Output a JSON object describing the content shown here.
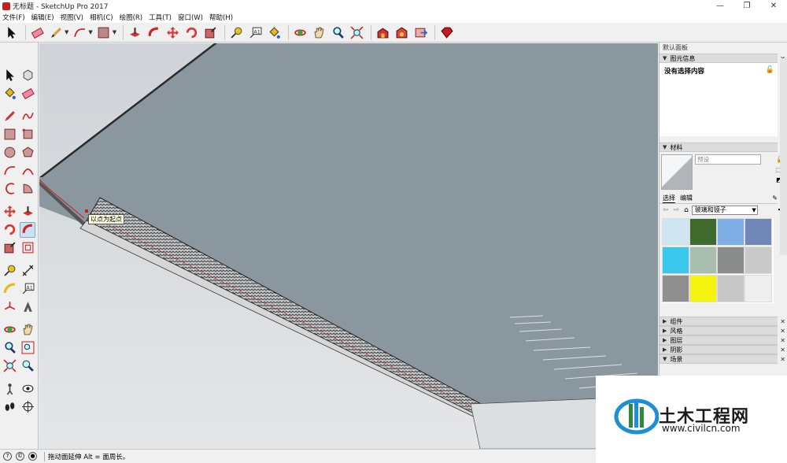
{
  "window": {
    "title": "无标题 - SketchUp Pro 2017",
    "controls": [
      "—",
      "❐",
      "✕"
    ]
  },
  "menu": [
    "文件(F)",
    "编辑(E)",
    "视图(V)",
    "相机(C)",
    "绘图(R)",
    "工具(T)",
    "窗口(W)",
    "帮助(H)"
  ],
  "toolbar": {
    "icons": [
      "select-icon",
      "eraser-icon",
      "pencil-icon",
      "arc-icon",
      "rectangle-icon",
      "push-pull-icon",
      "follow-me-icon",
      "move-icon",
      "rotate-icon",
      "scale-icon",
      "tape-measure-icon",
      "text-icon",
      "paint-bucket-icon",
      "orbit-icon",
      "pan-icon",
      "zoom-icon",
      "zoom-extents-icon",
      "warehouse-icon",
      "extension-warehouse-icon",
      "layout-icon",
      "ruby-icon"
    ]
  },
  "viewport": {
    "tooltip": "以点为起点"
  },
  "panel": {
    "title": "默认面板",
    "entity_info": {
      "header": "图元信息",
      "content": "没有选择内容"
    },
    "materials": {
      "header": "材料",
      "name_placeholder": "预设",
      "tabs": [
        "选择",
        "编辑"
      ],
      "library": "玻璃和镜子",
      "swatch_colors": [
        "#cfe6f2",
        "#3f6a2e",
        "#7faee6",
        "#6f86b6",
        "#39c8ec",
        "#a9bfae",
        "#8a8d8c",
        "#c9c9c9",
        "#8f8f8f",
        "#f6f40e",
        "#c7c7c7",
        "#eeeeee"
      ]
    },
    "collapsed_sections": [
      "组件",
      "风格",
      "图层",
      "阴影",
      "场景"
    ]
  },
  "status": {
    "text": "拖动面延伸  Alt = 面周长。"
  },
  "watermark": {
    "name": "土木工程网",
    "url": "www.civilcn.com"
  },
  "colors": {
    "sky": "#d9dcdf",
    "face": "#8a979f",
    "panel_bg": "#f0f0f0"
  }
}
